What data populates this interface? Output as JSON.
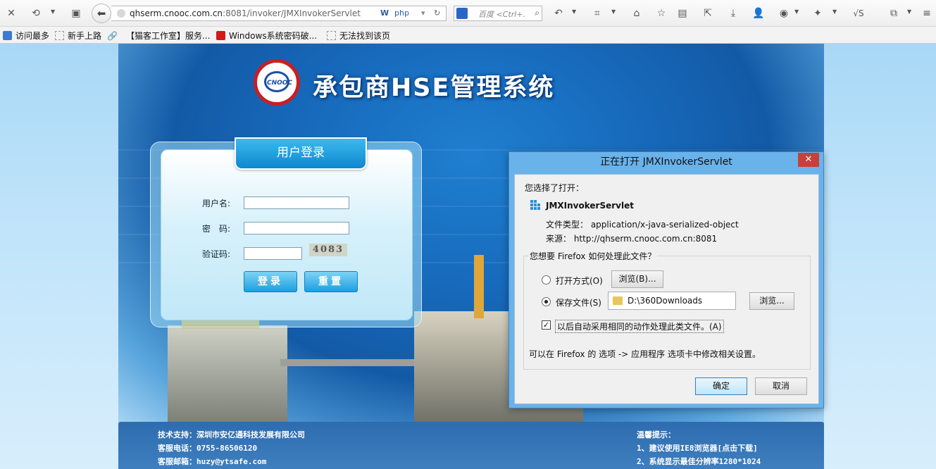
{
  "browser": {
    "url_host": "qhserm.cnooc.com.cn",
    "url_rest": ":8081/invoker/JMXInvokerServlet",
    "search_placeholder": "百度 <Ctrl+.",
    "js_label": "√S"
  },
  "bookmarks": [
    {
      "label": "访问最多",
      "icon": "magnifier-bookmark-icon"
    },
    {
      "label": "新手上路",
      "icon": "page-icon"
    },
    {
      "label": "【猫客工作室】服务...",
      "icon": "link-icon"
    },
    {
      "label": "Windows系统密码破...",
      "icon": "red-c-icon"
    },
    {
      "label": "无法找到该页",
      "icon": "page-icon"
    }
  ],
  "site": {
    "logo_text": "CNOOC",
    "title": "承包商HSE管理系统"
  },
  "login": {
    "tab_title": "用户登录",
    "username_label": "用户名:",
    "password_label": "密　码:",
    "captcha_label": "验证码:",
    "captcha_value": "4083",
    "login_button": "登录",
    "reset_button": "重置"
  },
  "footer": {
    "support": "技术支持：深圳市安亿通科技发展有限公司",
    "phone": "客服电话：0755-86506120",
    "email": "客服邮箱：huzy@ytsafe.com",
    "tip_title": "温馨提示：",
    "tip1": "1、建议使用IE8浏览器[点击下载]",
    "tip2": "2、系统显示最佳分辨率1280*1024"
  },
  "dialog": {
    "title": "正在打开 JMXInvokerServlet",
    "close": "✕",
    "chosen_label": "您选择了打开：",
    "filename": "JMXInvokerServlet",
    "filetype": "文件类型：  application/x-java-serialized-object",
    "source": "来源：  http://qhserm.cnooc.com.cn:8081",
    "question": "您想要 Firefox 如何处理此文件？",
    "open_with": "打开方式(O)",
    "browse1": "浏览(B)...",
    "save_file": "保存文件(S)",
    "save_path": "D:\\360Downloads",
    "browse2": "浏览...",
    "auto_checkbox": "以后自动采用相同的动作处理此类文件。(A)",
    "hint": "可以在 Firefox 的 选项 -> 应用程序 选项卡中修改相关设置。",
    "ok": "确定",
    "cancel": "取消"
  }
}
